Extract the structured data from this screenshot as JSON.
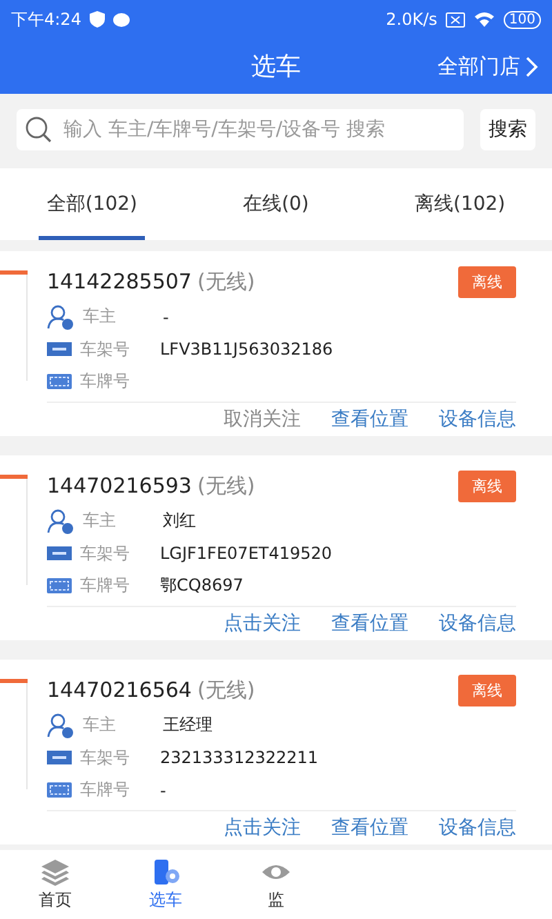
{
  "status_bar": {
    "time": "下午4:24",
    "speed": "2.0K/s",
    "battery": "100"
  },
  "header": {
    "title": "选车",
    "store_link": "全部门店"
  },
  "search": {
    "placeholder": "输入 车主/车牌号/车架号/设备号 搜索",
    "button": "搜索"
  },
  "tabs": [
    {
      "label": "全部(102)",
      "selected": true
    },
    {
      "label": "在线(0)",
      "selected": false
    },
    {
      "label": "离线(102)",
      "selected": false
    }
  ],
  "vehicles": [
    {
      "device": "14142285507",
      "signal": "(无线)",
      "status": "离线",
      "owner_label": "车主",
      "owner": "-",
      "vin_label": "车架号",
      "vin": "LFV3B11J563032186",
      "plate_label": "车牌号",
      "follow": "取消关注",
      "followed": true,
      "locate": "查看位置",
      "info": "设备信息"
    },
    {
      "device": "14470216593",
      "signal": "(无线)",
      "status": "离线",
      "owner_label": "车主",
      "owner": "刘红",
      "vin_label": "车架号",
      "vin": "LGJF1FE07ET419520",
      "plate_label": "车牌号",
      "plate": "鄂CQ8697",
      "follow": "点击关注",
      "followed": false,
      "locate": "查看位置",
      "info": "设备信息"
    },
    {
      "device": "14470216564",
      "signal": "(无线)",
      "status": "离线",
      "owner_label": "车主",
      "owner": "王经理",
      "vin_label": "车架号",
      "vin": "232133312322211",
      "plate_label": "车牌号",
      "plate": "-",
      "follow": "点击关注",
      "followed": false,
      "locate": "查看位置",
      "info": "设备信息"
    }
  ],
  "bottom_nav": [
    {
      "kind": "home",
      "label": "首页",
      "selected": false
    },
    {
      "kind": "car",
      "label": "选车",
      "selected": true
    },
    {
      "kind": "monitor",
      "label": "监",
      "selected": false
    }
  ]
}
